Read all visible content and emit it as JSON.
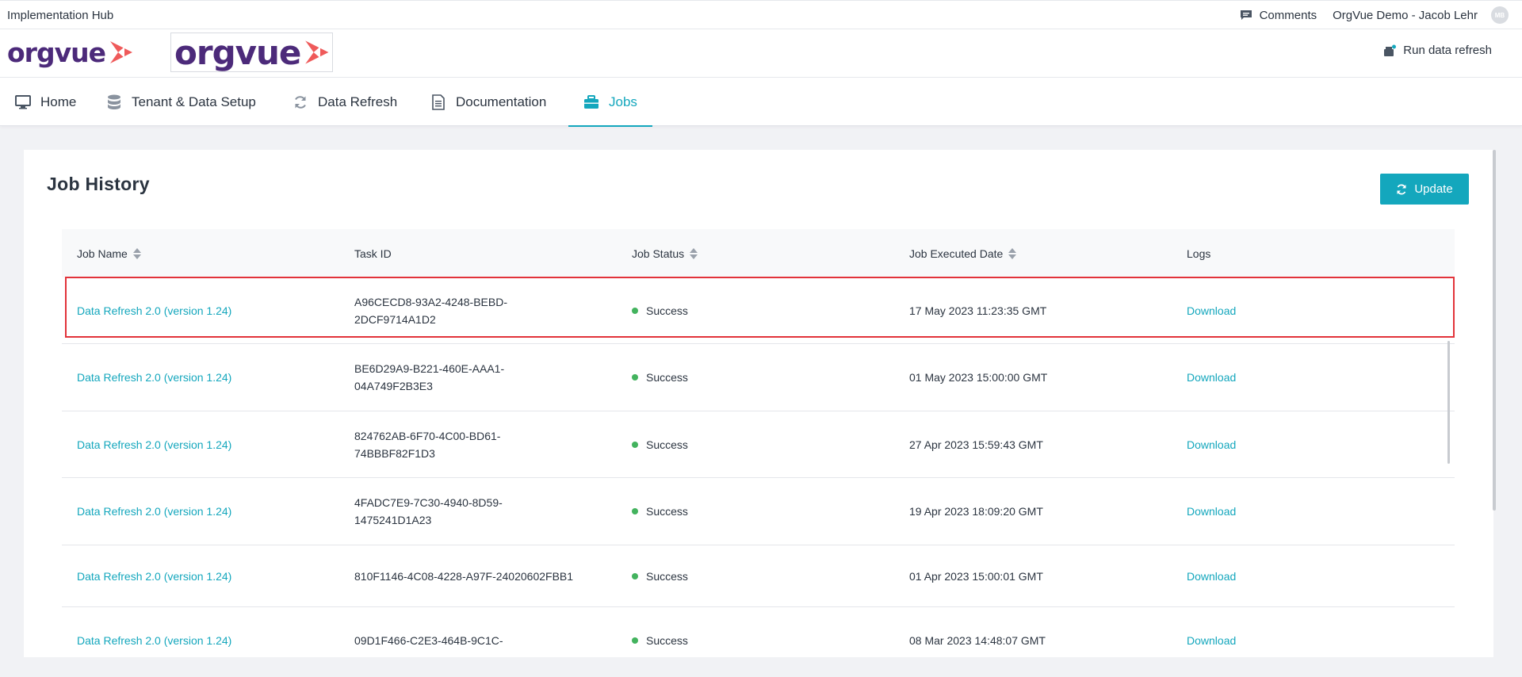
{
  "header": {
    "app_title": "Implementation Hub",
    "comments_label": "Comments",
    "user_name": "OrgVue Demo - Jacob Lehr",
    "avatar_initials": "MB"
  },
  "logobar": {
    "logo_text": "orgvue",
    "run_refresh_label": "Run data refresh"
  },
  "nav": {
    "tabs": [
      {
        "label": "Home",
        "icon": "monitor-icon"
      },
      {
        "label": "Tenant & Data Setup",
        "icon": "database-icon"
      },
      {
        "label": "Data Refresh",
        "icon": "refresh-icon"
      },
      {
        "label": "Documentation",
        "icon": "document-icon"
      },
      {
        "label": "Jobs",
        "icon": "briefcase-icon",
        "active": true
      }
    ]
  },
  "main": {
    "title": "Job History",
    "update_label": "Update",
    "columns": [
      "Job Name",
      "Task ID",
      "Job Status",
      "Job Executed Date",
      "Logs"
    ],
    "rows": [
      {
        "job_name": "Data Refresh 2.0 (version 1.24)",
        "task_id_1": "A96CECD8-93A2-4248-BEBD-",
        "task_id_2": "2DCF9714A1D2",
        "status": "Success",
        "date": "17 May 2023 11:23:35 GMT",
        "log": "Download"
      },
      {
        "job_name": "Data Refresh 2.0 (version 1.24)",
        "task_id_1": "BE6D29A9-B221-460E-AAA1-",
        "task_id_2": "04A749F2B3E3",
        "status": "Success",
        "date": "01 May 2023 15:00:00 GMT",
        "log": "Download"
      },
      {
        "job_name": "Data Refresh 2.0 (version 1.24)",
        "task_id_1": "824762AB-6F70-4C00-BD61-",
        "task_id_2": "74BBBF82F1D3",
        "status": "Success",
        "date": "27 Apr 2023 15:59:43 GMT",
        "log": "Download"
      },
      {
        "job_name": "Data Refresh 2.0 (version 1.24)",
        "task_id_1": "4FADC7E9-7C30-4940-8D59-",
        "task_id_2": "1475241D1A23",
        "status": "Success",
        "date": "19 Apr 2023 18:09:20 GMT",
        "log": "Download"
      },
      {
        "job_name": "Data Refresh 2.0 (version 1.24)",
        "task_id_1": "810F1146-4C08-4228-A97F-24020602FBB1",
        "task_id_2": "",
        "status": "Success",
        "date": "01 Apr 2023 15:00:01 GMT",
        "log": "Download"
      },
      {
        "job_name": "Data Refresh 2.0 (version 1.24)",
        "task_id_1": "09D1F466-C2E3-464B-9C1C-",
        "task_id_2": "",
        "status": "Success",
        "date": "08 Mar 2023 14:48:07 GMT",
        "log": "Download"
      }
    ]
  },
  "colors": {
    "accent": "#14a7bd",
    "brand_purple": "#4c2a7a",
    "brand_coral": "#ef5a5a",
    "success": "#43b35e",
    "highlight": "#e2333a"
  }
}
